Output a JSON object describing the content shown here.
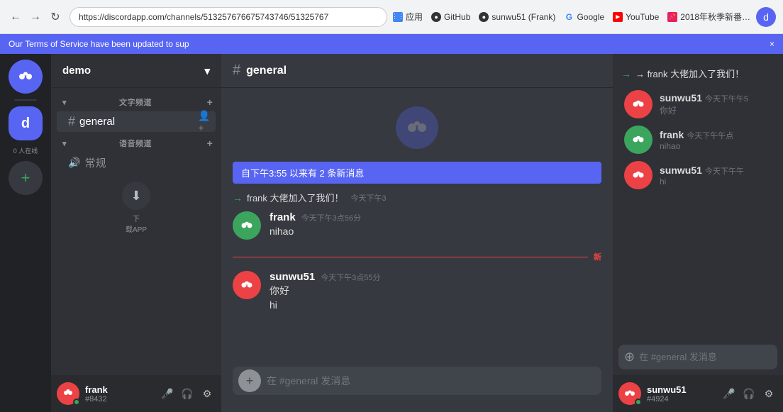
{
  "browser": {
    "url": "https://discordapp.com/channels/513257676675743746/51325767",
    "bookmarks": [
      {
        "label": "应用",
        "icon": "grid",
        "color": "#4285f4"
      },
      {
        "label": "GitHub",
        "icon": "github",
        "color": "#333"
      },
      {
        "label": "sunwu51 (Frank)",
        "icon": "github",
        "color": "#333"
      },
      {
        "label": "Google",
        "icon": "google",
        "color": ""
      },
      {
        "label": "YouTube",
        "icon": "youtube",
        "color": "#ff0000"
      },
      {
        "label": "2018年秋季新番…",
        "icon": "bookmark",
        "color": "#e91e63"
      }
    ],
    "nav": {
      "back": "←",
      "forward": "→",
      "refresh": "↻"
    }
  },
  "notification": {
    "text": "Our Terms of Service have been updated to sup",
    "close": "×"
  },
  "server": {
    "name": "demo",
    "online_count": "0 人在线"
  },
  "channels": {
    "text_category": "文字频道",
    "voice_category": "语音频道",
    "text_channels": [
      {
        "name": "general",
        "active": true
      }
    ],
    "voice_channels": [
      {
        "name": "常规",
        "icon": "🔊"
      }
    ]
  },
  "chat": {
    "channel_name": "general",
    "new_messages_banner": "自下午3:55 以来有 2 条新消息",
    "system_join": "frank 大佬加入了我们！",
    "system_join_time": "今天下午3",
    "messages": [
      {
        "id": 1,
        "username": "frank",
        "time": "今天下午3点56分",
        "avatar_color": "green",
        "texts": [
          "nihao"
        ]
      },
      {
        "id": 2,
        "username": "sunwu51",
        "time": "今天下午3点55分",
        "avatar_color": "red",
        "texts": [
          "你好",
          "hi"
        ]
      }
    ],
    "new_divider": "新",
    "input_placeholder": "在 #general 发消息"
  },
  "members_panel": {
    "join_text": "→ frank 大佬加入了我们！",
    "members": [
      {
        "username": "sunwu51",
        "time": "今天下午午5",
        "message": "你好",
        "avatar_color": "red"
      },
      {
        "username": "frank",
        "time": "今天下午午点",
        "message": "nihao",
        "avatar_color": "green"
      },
      {
        "username": "sunwu51",
        "time": "今天下午午",
        "message": "hi",
        "avatar_color": "red"
      }
    ],
    "input_placeholder": "在 #general 发消息"
  },
  "left_user": {
    "name": "frank",
    "tag": "#8432",
    "avatar_color": "red"
  },
  "right_user": {
    "name": "sunwu51",
    "tag": "#4924",
    "avatar_color": "red"
  },
  "download": {
    "label": "下\n载APP"
  },
  "icons": {
    "discord": "🎮",
    "hash": "#",
    "chevron_down": "▾",
    "plus": "+",
    "mic": "🎤",
    "headset": "🎧",
    "settings": "⚙",
    "mute": "🔇",
    "download": "⬇",
    "add_circle": "⊕"
  }
}
